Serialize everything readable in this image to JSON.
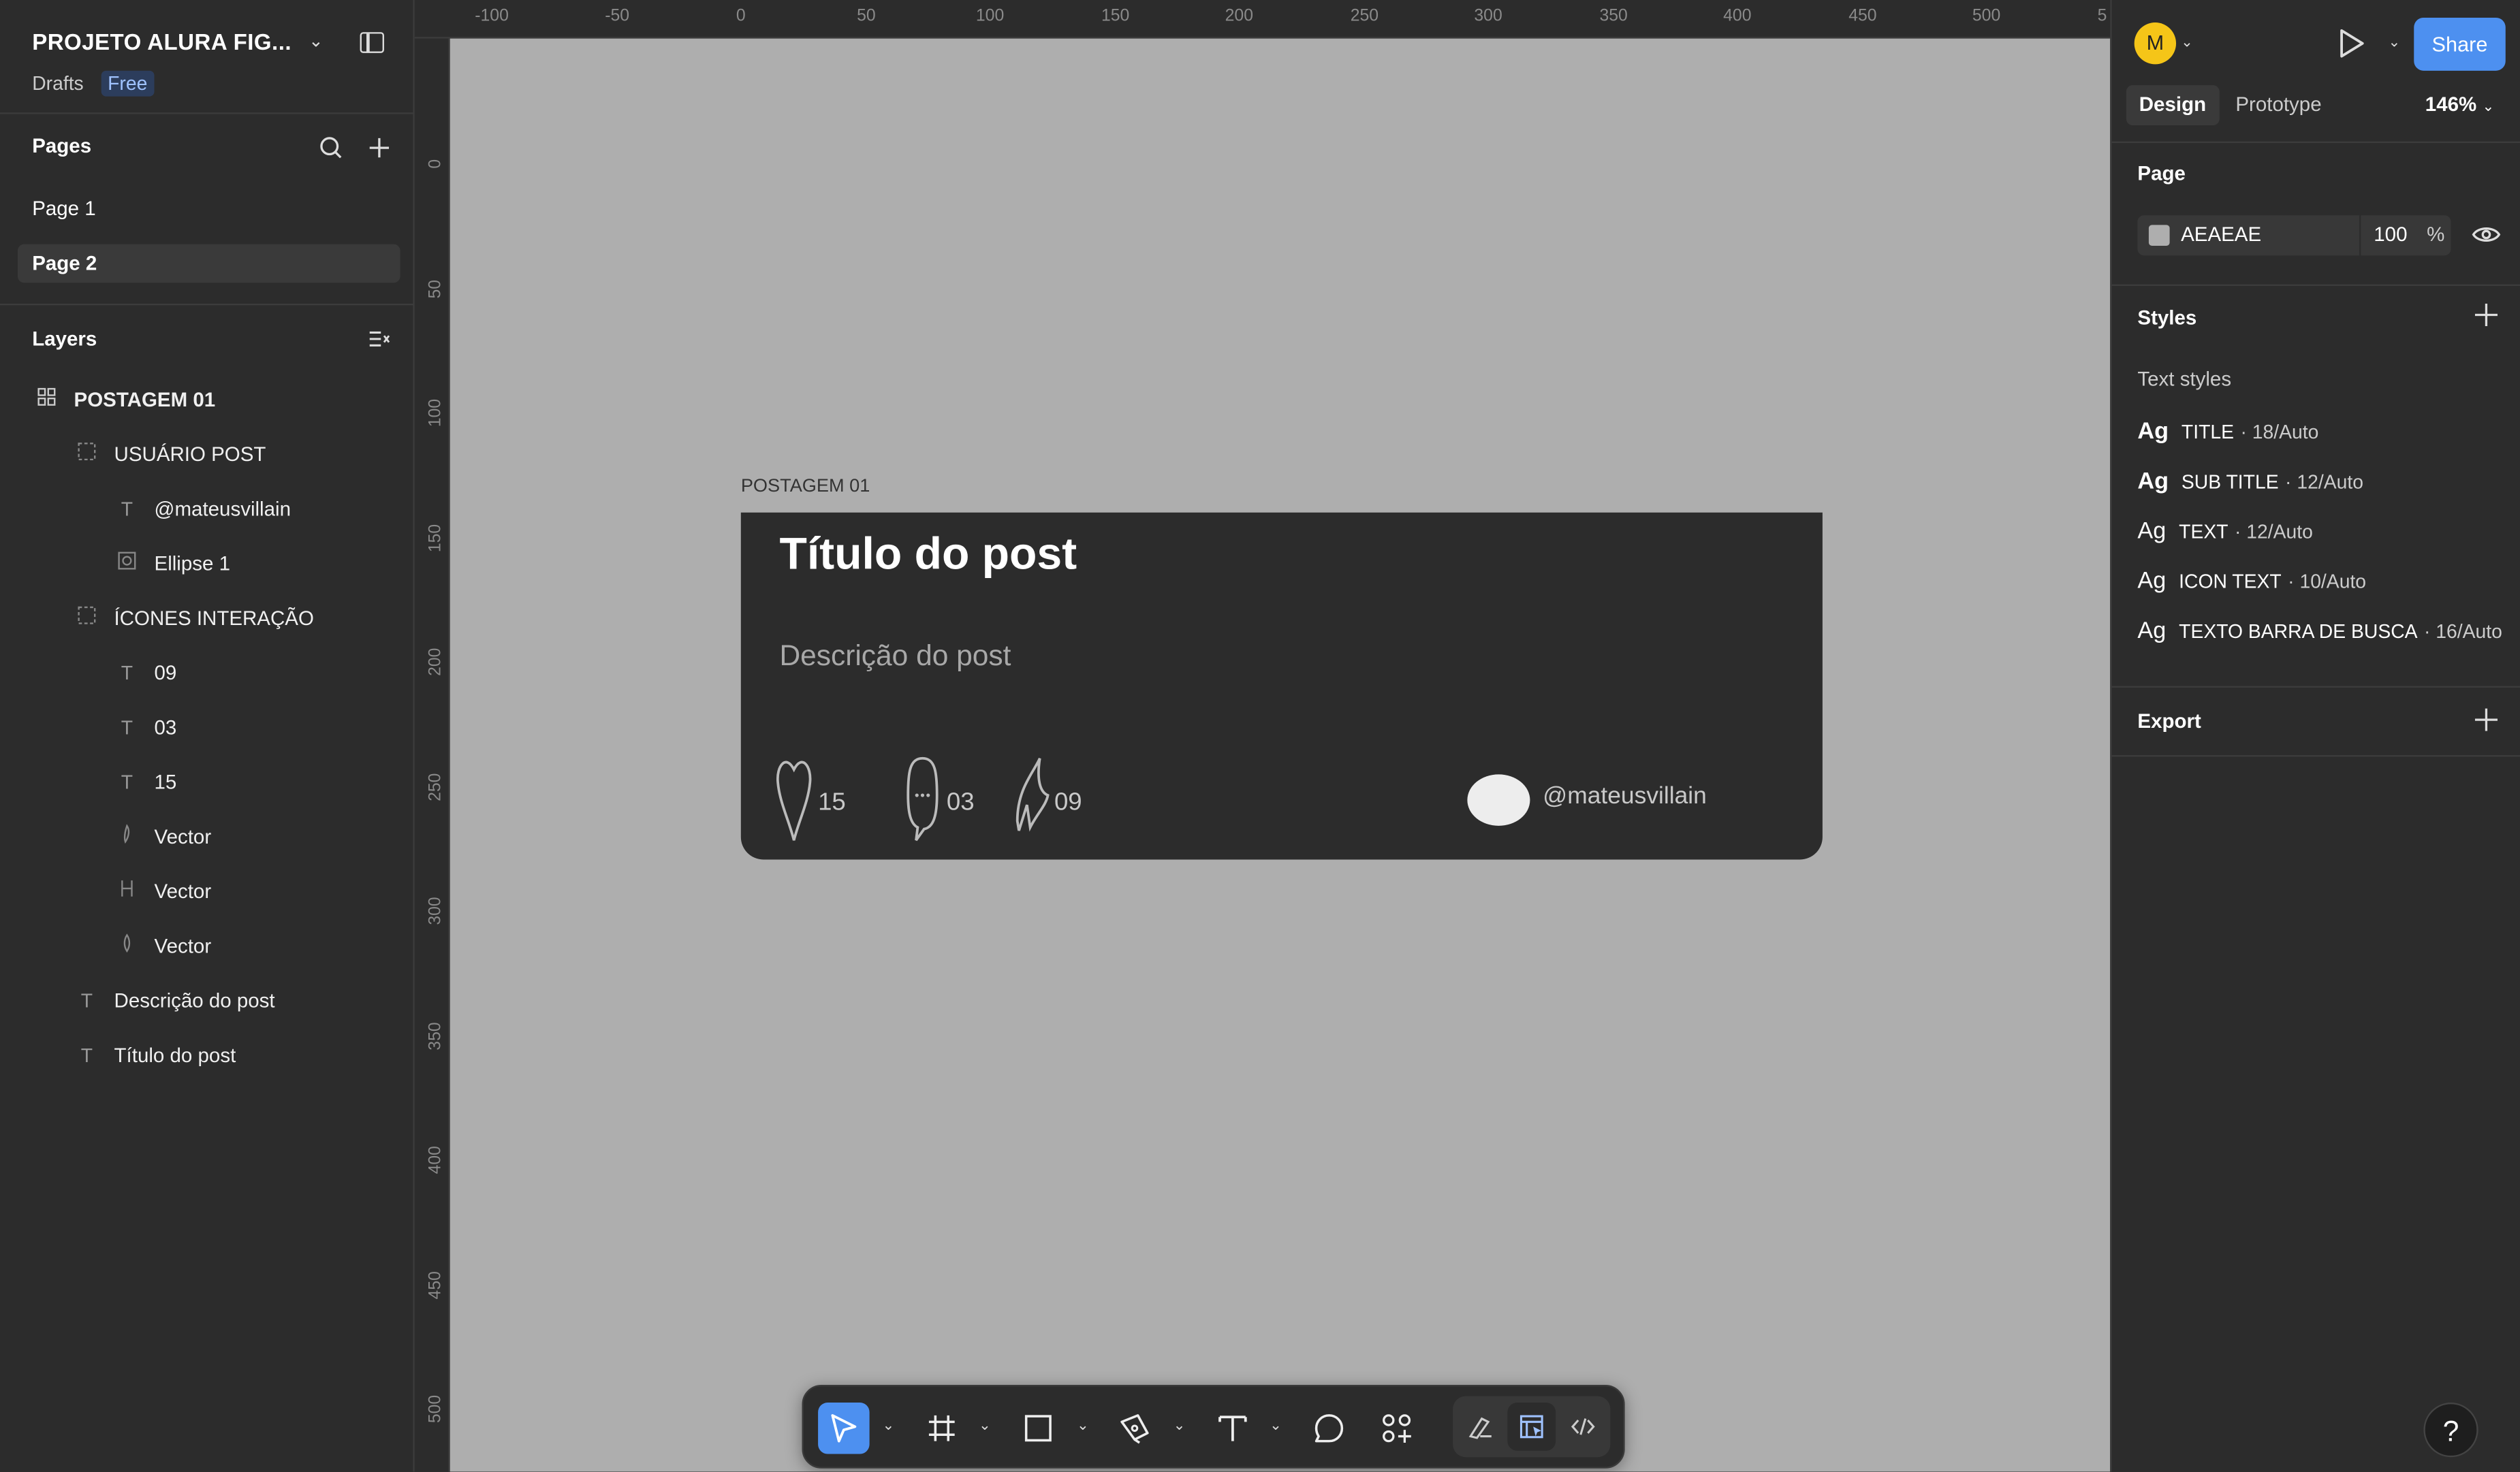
{
  "left_sidebar": {
    "project_name": "PROJETO ALURA FIG...",
    "location": "Drafts",
    "plan_badge": "Free",
    "pages_title": "Pages",
    "pages": [
      {
        "label": "Page 1",
        "active": false
      },
      {
        "label": "Page 2",
        "active": true
      }
    ],
    "layers_title": "Layers",
    "layers": [
      {
        "label": "POSTAGEM 01",
        "icon": "component-icon",
        "depth": 0
      },
      {
        "label": "USUÁRIO POST",
        "icon": "group-icon",
        "depth": 1
      },
      {
        "label": "@mateusvillain",
        "icon": "text-icon",
        "depth": 2
      },
      {
        "label": "Ellipse 1",
        "icon": "image-icon",
        "depth": 2
      },
      {
        "label": "ÍCONES INTERAÇÃO",
        "icon": "group-icon",
        "depth": 1
      },
      {
        "label": "09",
        "icon": "text-icon",
        "depth": 2
      },
      {
        "label": "03",
        "icon": "text-icon",
        "depth": 2
      },
      {
        "label": "15",
        "icon": "text-icon",
        "depth": 2
      },
      {
        "label": "Vector",
        "icon": "vector-icon",
        "depth": 2
      },
      {
        "label": "Vector",
        "icon": "vector-icon",
        "depth": 2
      },
      {
        "label": "Vector",
        "icon": "vector-icon",
        "depth": 2
      },
      {
        "label": "Descrição do post",
        "icon": "text-icon",
        "depth": 1
      },
      {
        "label": "Título do post",
        "icon": "text-icon",
        "depth": 1
      }
    ]
  },
  "rulers": {
    "x_ticks": [
      "-100",
      "-50",
      "0",
      "50",
      "100",
      "150",
      "200",
      "250",
      "300",
      "350",
      "400",
      "450",
      "500",
      "5"
    ],
    "y_ticks": [
      "0",
      "50",
      "100",
      "150",
      "200",
      "250",
      "300",
      "350",
      "400",
      "450",
      "500"
    ]
  },
  "canvas": {
    "background": "#AEAEAE",
    "frame_label": "POSTAGEM 01",
    "post": {
      "title": "Título do post",
      "description": "Descrição do post",
      "likes": "15",
      "comments": "03",
      "shares": "09",
      "username": "@mateusvillain"
    }
  },
  "toolbar": {
    "tools": [
      "move-tool",
      "frame-tool",
      "shape-tool",
      "pen-tool",
      "text-tool",
      "comment-tool",
      "actions-tool"
    ],
    "modes": [
      "draw-mode",
      "design-mode",
      "dev-mode"
    ]
  },
  "right_panel": {
    "user_initial": "M",
    "share_label": "Share",
    "tabs": [
      "Design",
      "Prototype"
    ],
    "zoom": "146%",
    "page_title": "Page",
    "page_color_hex": "AEAEAE",
    "page_opacity": "100",
    "page_opacity_unit": "%",
    "styles_title": "Styles",
    "text_styles_title": "Text styles",
    "text_styles": [
      {
        "preview": "Ag",
        "name": "TITLE",
        "meta": "· 18/Auto",
        "bold": true
      },
      {
        "preview": "Ag",
        "name": "SUB TITLE",
        "meta": "· 12/Auto",
        "bold": true
      },
      {
        "preview": "Ag",
        "name": "TEXT",
        "meta": "· 12/Auto",
        "bold": false
      },
      {
        "preview": "Ag",
        "name": "ICON TEXT",
        "meta": "· 10/Auto",
        "bold": false
      },
      {
        "preview": "Ag",
        "name": "TEXTO BARRA DE BUSCA",
        "meta": "· 16/Auto",
        "bold": false
      }
    ],
    "export_title": "Export",
    "help_label": "?"
  },
  "colors": {
    "accent": "#4D90F0",
    "panel": "#2C2C2C",
    "canvas": "#AEAEAE",
    "avatar": "#F5C518"
  }
}
